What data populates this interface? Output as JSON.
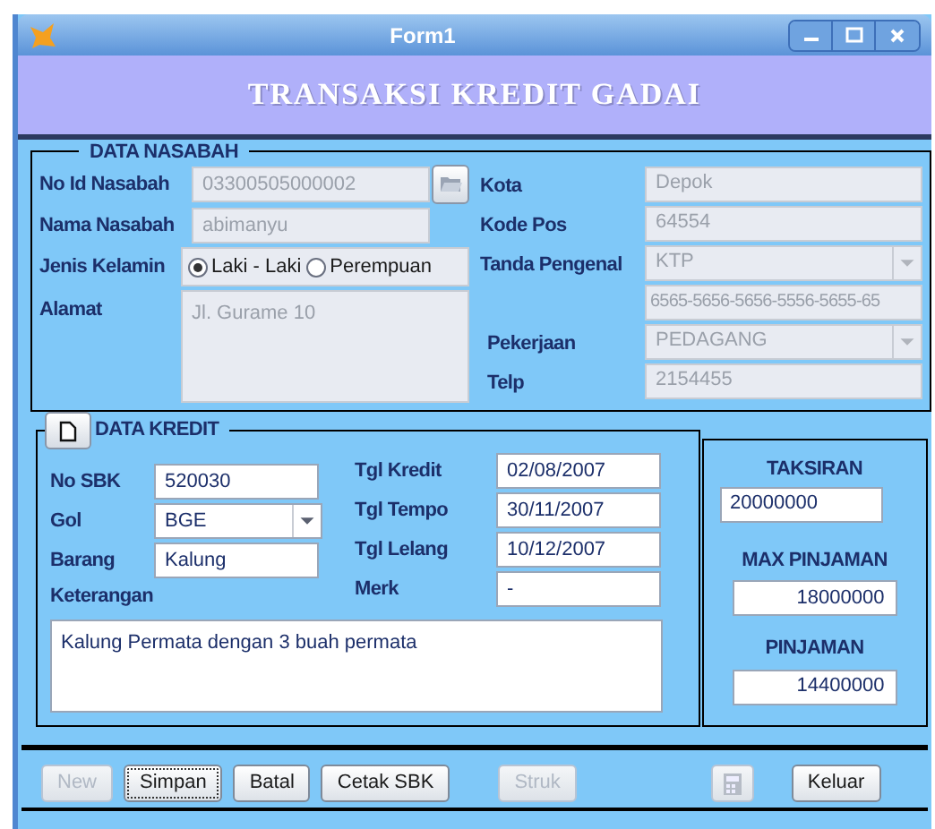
{
  "window": {
    "title": "Form1"
  },
  "header": {
    "title": "TRANSAKSI KREDIT GADAI"
  },
  "customer": {
    "legend": "DATA NASABAH",
    "id": {
      "label": "No Id Nasabah",
      "value": "03300505000002",
      "disabled": true
    },
    "name": {
      "label": "Nama Nasabah",
      "value": "abimanyu",
      "disabled": true
    },
    "gender": {
      "label": "Jenis Kelamin",
      "options": [
        {
          "label": "Laki - Laki",
          "selected": true
        },
        {
          "label": "Perempuan",
          "selected": false
        }
      ]
    },
    "address": {
      "label": "Alamat",
      "value": "Jl. Gurame 10",
      "disabled": true
    },
    "city": {
      "label": "Kota",
      "value": "Depok",
      "disabled": true
    },
    "postal_code": {
      "label": "Kode Pos",
      "value": "64554",
      "disabled": true
    },
    "id_card": {
      "label": "Tanda Pengenal",
      "value": "KTP",
      "disabled": true
    },
    "id_card_number": {
      "value": "6565-5656-5656-5556-5655-65",
      "disabled": true
    },
    "job": {
      "label": "Pekerjaan",
      "value": "PEDAGANG",
      "disabled": true
    },
    "phone": {
      "label": "Telp",
      "value": "2154455",
      "disabled": true
    }
  },
  "credit": {
    "legend": "DATA KREDIT",
    "sbk_no": {
      "label": "No SBK",
      "value": "520030",
      "disabled": false
    },
    "group": {
      "label": "Gol",
      "value": "BGE",
      "disabled": false
    },
    "item": {
      "label": "Barang",
      "value": "Kalung",
      "disabled": false
    },
    "note": {
      "label": "Keterangan",
      "value": "Kalung Permata dengan 3 buah permata",
      "disabled": false
    },
    "credit_date": {
      "label": "Tgl Kredit",
      "value": "02/08/2007",
      "disabled": false
    },
    "due_date": {
      "label": "Tgl Tempo",
      "value": "30/11/2007",
      "disabled": false
    },
    "auction_date": {
      "label": "Tgl Lelang",
      "value": "10/12/2007",
      "disabled": false
    },
    "brand": {
      "label": "Merk",
      "value": "-",
      "disabled": false
    }
  },
  "summary": {
    "appraisal": {
      "label": "TAKSIRAN",
      "value": "20000000",
      "disabled": false
    },
    "max_loan": {
      "label": "MAX PINJAMAN",
      "value": "18000000",
      "disabled": false
    },
    "loan": {
      "label": "PINJAMAN",
      "value": "14400000",
      "disabled": false
    }
  },
  "buttons": [
    {
      "kind": "text",
      "label": "New",
      "disabled": true,
      "focused": false
    },
    {
      "kind": "text",
      "label": "Simpan",
      "disabled": false,
      "focused": true
    },
    {
      "kind": "text",
      "label": "Batal",
      "disabled": false,
      "focused": false
    },
    {
      "kind": "text",
      "label": "Cetak SBK",
      "disabled": false,
      "focused": false
    },
    {
      "kind": "text",
      "label": "Struk",
      "disabled": true,
      "focused": false
    },
    {
      "kind": "icon",
      "disabled": true,
      "focused": false
    },
    {
      "kind": "text",
      "label": "Keluar",
      "disabled": false,
      "focused": false
    }
  ]
}
